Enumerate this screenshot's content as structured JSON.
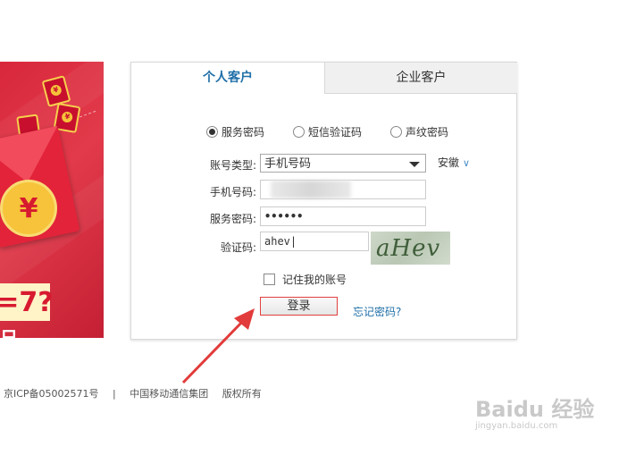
{
  "banner": {
    "coin_symbol": "¥",
    "price_fragment": "=7?",
    "day_text": "日"
  },
  "tabs": {
    "personal": "个人客户",
    "enterprise": "企业客户"
  },
  "login_type": {
    "options": [
      "服务密码",
      "短信验证码",
      "声纹密码"
    ],
    "selected": "服务密码"
  },
  "form": {
    "account_type_label": "账号类型:",
    "account_type_value": "手机号码",
    "province": "安徽",
    "phone_label": "手机号码:",
    "phone_value": "",
    "password_label": "服务密码:",
    "password_value": "••••••",
    "captcha_label": "验证码:",
    "captcha_value": "ahev",
    "captcha_image_text": "aHev",
    "remember_label": "记住我的账号",
    "login_button": "登录",
    "forgot_link": "忘记密码?"
  },
  "footer": {
    "icp": "京ICP备05002571号",
    "separator": "|",
    "company": "中国移动通信集团",
    "rights": "版权所有"
  },
  "watermark": {
    "brand": "Baidu 经验",
    "url": "jingyan.baidu.com"
  },
  "colors": {
    "accent_blue": "#1f6fa8",
    "banner_red": "#d8283c",
    "arrow_red": "#e23b3b"
  }
}
